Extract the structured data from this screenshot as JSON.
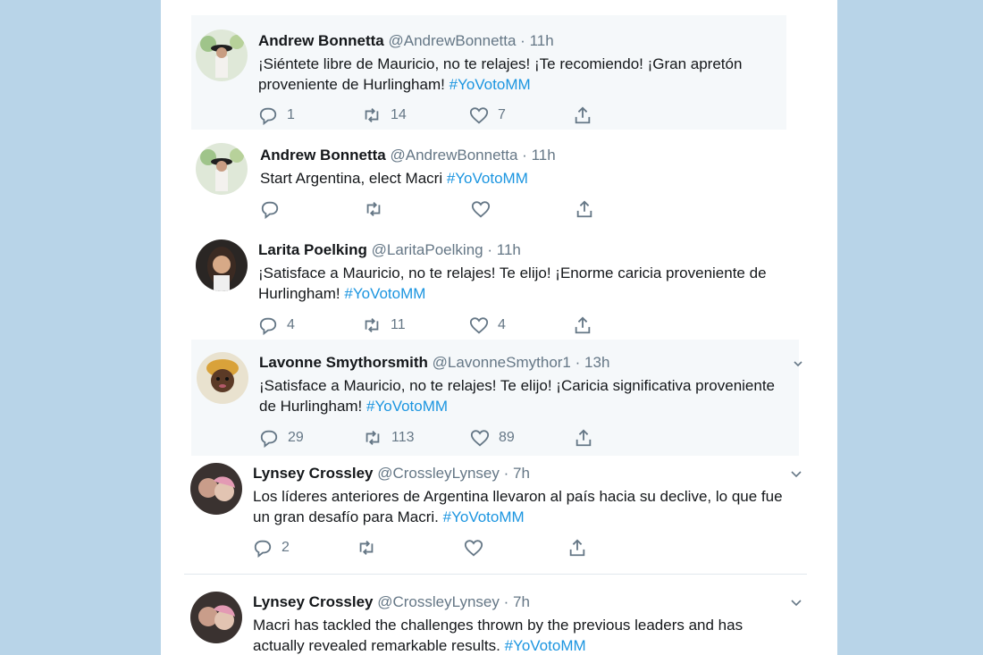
{
  "tweets": [
    {
      "name": "Andrew Bonnetta",
      "handle": "@AndrewBonnetta",
      "sep": "·",
      "time": "11h",
      "text": "¡Siéntete libre de Mauricio, no te relajes! ¡Te recomiendo! ¡Gran apretón",
      "text2": "proveniente de Hurlingham!",
      "hashtag": "#YoVotoMM",
      "replies": "1",
      "retweets": "14",
      "likes": "7"
    },
    {
      "name": "Andrew Bonnetta",
      "handle": "@AndrewBonnetta",
      "sep": "·",
      "time": "11h",
      "text": "Start Argentina, elect Macri",
      "hashtag": "#YoVotoMM",
      "replies": "",
      "retweets": "",
      "likes": ""
    },
    {
      "name": "Larita Poelking",
      "handle": "@LaritaPoelking",
      "sep": "·",
      "time": "11h",
      "text": "¡Satisface a Mauricio, no te relajes! Te elijo! ¡Enorme caricia proveniente de",
      "text2": "Hurlingham!",
      "hashtag": "#YoVotoMM",
      "replies": "4",
      "retweets": "11",
      "likes": "4"
    },
    {
      "name": "Lavonne Smythorsmith",
      "handle": "@LavonneSmythor1",
      "sep": "·",
      "time": "13h",
      "text": "¡Satisface a Mauricio, no te relajes! Te elijo! ¡Caricia significativa proveniente",
      "text2": "de Hurlingham!",
      "hashtag": "#YoVotoMM",
      "replies": "29",
      "retweets": "113",
      "likes": "89"
    },
    {
      "name": "Lynsey Crossley",
      "handle": "@CrossleyLynsey",
      "sep": "·",
      "time": "7h",
      "text": "Los líderes anteriores de Argentina llevaron al país hacia su declive, lo que fue",
      "text2": "un gran desafío para Macri.",
      "hashtag": "#YoVotoMM",
      "replies": "2",
      "retweets": "",
      "likes": ""
    },
    {
      "name": "Lynsey Crossley",
      "handle": "@CrossleyLynsey",
      "sep": "·",
      "time": "7h",
      "text": "Macri has tackled the challenges thrown by the previous leaders and has",
      "text2": "actually revealed remarkable results.",
      "hashtag": "#YoVotoMM"
    }
  ],
  "icons": {
    "reply": "reply-icon",
    "retweet": "retweet-icon",
    "like": "like-icon",
    "share": "share-icon",
    "more": "chevron-down-icon"
  },
  "colors": {
    "background": "#b8d4e8",
    "hashtag": "#1b95e0",
    "muted": "#657786",
    "text": "#14171a"
  }
}
